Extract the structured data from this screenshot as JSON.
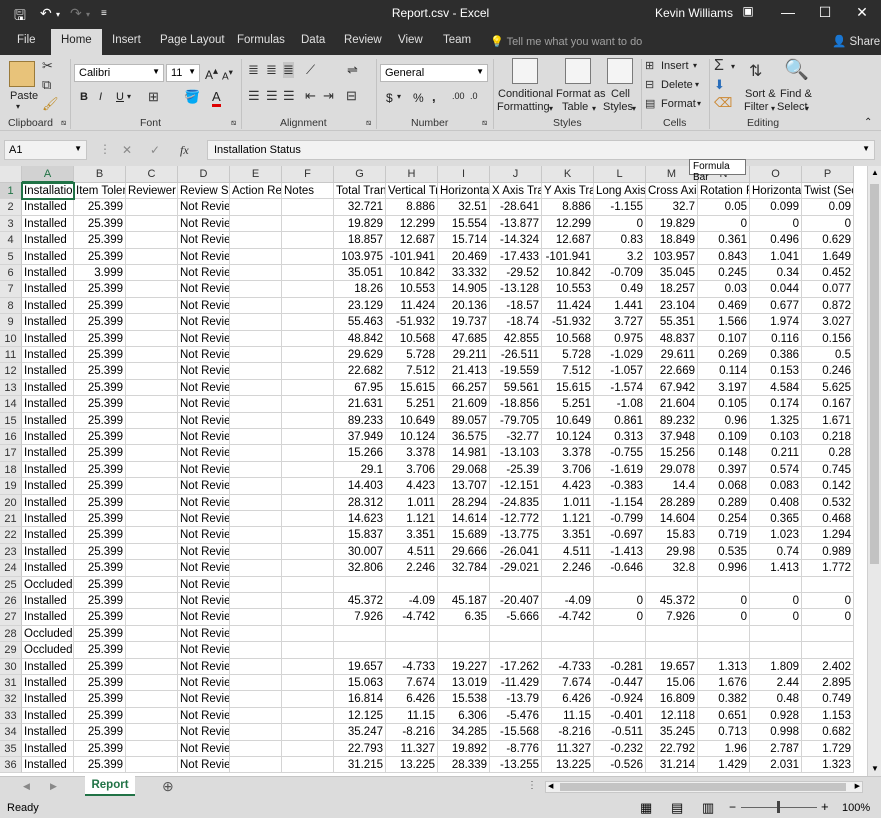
{
  "window": {
    "title": "Report.csv  -  Excel",
    "user": "Kevin Williams"
  },
  "tabs": [
    "File",
    "Home",
    "Insert",
    "Page Layout",
    "Formulas",
    "Data",
    "Review",
    "View",
    "Team"
  ],
  "tell_me": "Tell me what you want to do",
  "share": "Share",
  "ribbon": {
    "clipboard": {
      "label": "Clipboard",
      "paste": "Paste"
    },
    "font": {
      "label": "Font",
      "name": "Calibri",
      "size": "11",
      "bold": "B",
      "italic": "I",
      "underline": "U"
    },
    "alignment": {
      "label": "Alignment"
    },
    "number": {
      "label": "Number",
      "format": "General",
      "currency": "$",
      "percent": "%",
      "comma": ","
    },
    "styles": {
      "label": "Styles",
      "conditional": "Conditional",
      "formatting": "Formatting",
      "format_as": "Format as",
      "table": "Table",
      "cell": "Cell",
      "styles": "Styles"
    },
    "cells": {
      "label": "Cells",
      "insert": "Insert",
      "delete": "Delete",
      "format": "Format"
    },
    "editing": {
      "label": "Editing",
      "sort": "Sort &",
      "filter": "Filter",
      "find": "Find &",
      "select": "Select"
    }
  },
  "formula_bar": {
    "name_box": "A1",
    "fx": "fx",
    "content": "Installation Status",
    "tooltip": "Formula Bar"
  },
  "columns": [
    "A",
    "B",
    "C",
    "D",
    "E",
    "F",
    "G",
    "H",
    "I",
    "J",
    "K",
    "L",
    "M",
    "N",
    "O",
    "P"
  ],
  "header_row": [
    "Installation Status",
    "Item Tolerance",
    "Reviewer",
    "Review Status",
    "Action Required",
    "Notes",
    "Total Translation",
    "Vertical Translation",
    "Horizontal Translation",
    "X Axis Translation",
    "Y Axis Translation",
    "Long Axis",
    "Cross Axis",
    "Rotation F",
    "Horizontal",
    "Twist (Sec G"
  ],
  "rows": [
    [
      "Installed",
      "25.399",
      "",
      "Not Reviewed",
      "",
      "",
      "32.721",
      "8.886",
      "32.51",
      "-28.641",
      "8.886",
      "-1.155",
      "32.7",
      "0.05",
      "0.099",
      "0.09"
    ],
    [
      "Installed",
      "25.399",
      "",
      "Not Reviewed",
      "",
      "",
      "19.829",
      "12.299",
      "15.554",
      "-13.877",
      "12.299",
      "0",
      "19.829",
      "0",
      "0",
      "0"
    ],
    [
      "Installed",
      "25.399",
      "",
      "Not Reviewed",
      "",
      "",
      "18.857",
      "12.687",
      "15.714",
      "-14.324",
      "12.687",
      "0.83",
      "18.849",
      "0.361",
      "0.496",
      "0.629"
    ],
    [
      "Installed",
      "25.399",
      "",
      "Not Reviewed",
      "",
      "",
      "103.975",
      "-101.941",
      "20.469",
      "-17.433",
      "-101.941",
      "3.2",
      "103.957",
      "0.843",
      "1.041",
      "1.649"
    ],
    [
      "Installed",
      "3.999",
      "",
      "Not Reviewed",
      "",
      "",
      "35.051",
      "10.842",
      "33.332",
      "-29.52",
      "10.842",
      "-0.709",
      "35.045",
      "0.245",
      "0.34",
      "0.452"
    ],
    [
      "Installed",
      "25.399",
      "",
      "Not Reviewed",
      "",
      "",
      "18.26",
      "10.553",
      "14.905",
      "-13.128",
      "10.553",
      "0.49",
      "18.257",
      "0.03",
      "0.044",
      "0.077"
    ],
    [
      "Installed",
      "25.399",
      "",
      "Not Reviewed",
      "",
      "",
      "23.129",
      "11.424",
      "20.136",
      "-18.57",
      "11.424",
      "1.441",
      "23.104",
      "0.469",
      "0.677",
      "0.872"
    ],
    [
      "Installed",
      "25.399",
      "",
      "Not Reviewed",
      "",
      "",
      "55.463",
      "-51.932",
      "19.737",
      "-18.74",
      "-51.932",
      "3.727",
      "55.351",
      "1.566",
      "1.974",
      "3.027"
    ],
    [
      "Installed",
      "25.399",
      "",
      "Not Reviewed",
      "",
      "",
      "48.842",
      "10.568",
      "47.685",
      "42.855",
      "10.568",
      "0.975",
      "48.837",
      "0.107",
      "0.116",
      "0.156"
    ],
    [
      "Installed",
      "25.399",
      "",
      "Not Reviewed",
      "",
      "",
      "29.629",
      "5.728",
      "29.211",
      "-26.511",
      "5.728",
      "-1.029",
      "29.611",
      "0.269",
      "0.386",
      "0.5"
    ],
    [
      "Installed",
      "25.399",
      "",
      "Not Reviewed",
      "",
      "",
      "22.682",
      "7.512",
      "21.413",
      "-19.559",
      "7.512",
      "-1.057",
      "22.669",
      "0.114",
      "0.153",
      "0.246"
    ],
    [
      "Installed",
      "25.399",
      "",
      "Not Reviewed",
      "",
      "",
      "67.95",
      "15.615",
      "66.257",
      "59.561",
      "15.615",
      "-1.574",
      "67.942",
      "3.197",
      "4.584",
      "5.625"
    ],
    [
      "Installed",
      "25.399",
      "",
      "Not Reviewed",
      "",
      "",
      "21.631",
      "5.251",
      "21.609",
      "-18.856",
      "5.251",
      "-1.08",
      "21.604",
      "0.105",
      "0.174",
      "0.167"
    ],
    [
      "Installed",
      "25.399",
      "",
      "Not Reviewed",
      "",
      "",
      "89.233",
      "10.649",
      "89.057",
      "-79.705",
      "10.649",
      "0.861",
      "89.232",
      "0.96",
      "1.325",
      "1.671"
    ],
    [
      "Installed",
      "25.399",
      "",
      "Not Reviewed",
      "",
      "",
      "37.949",
      "10.124",
      "36.575",
      "-32.77",
      "10.124",
      "0.313",
      "37.948",
      "0.109",
      "0.103",
      "0.218"
    ],
    [
      "Installed",
      "25.399",
      "",
      "Not Reviewed",
      "",
      "",
      "15.266",
      "3.378",
      "14.981",
      "-13.103",
      "3.378",
      "-0.755",
      "15.256",
      "0.148",
      "0.211",
      "0.28"
    ],
    [
      "Installed",
      "25.399",
      "",
      "Not Reviewed",
      "",
      "",
      "29.1",
      "3.706",
      "29.068",
      "-25.39",
      "3.706",
      "-1.619",
      "29.078",
      "0.397",
      "0.574",
      "0.745"
    ],
    [
      "Installed",
      "25.399",
      "",
      "Not Reviewed",
      "",
      "",
      "14.403",
      "4.423",
      "13.707",
      "-12.151",
      "4.423",
      "-0.383",
      "14.4",
      "0.068",
      "0.083",
      "0.142"
    ],
    [
      "Installed",
      "25.399",
      "",
      "Not Reviewed",
      "",
      "",
      "28.312",
      "1.011",
      "28.294",
      "-24.835",
      "1.011",
      "-1.154",
      "28.289",
      "0.289",
      "0.408",
      "0.532"
    ],
    [
      "Installed",
      "25.399",
      "",
      "Not Reviewed",
      "",
      "",
      "14.623",
      "1.121",
      "14.614",
      "-12.772",
      "1.121",
      "-0.799",
      "14.604",
      "0.254",
      "0.365",
      "0.468"
    ],
    [
      "Installed",
      "25.399",
      "",
      "Not Reviewed",
      "",
      "",
      "15.837",
      "3.351",
      "15.689",
      "-13.775",
      "3.351",
      "-0.697",
      "15.83",
      "0.719",
      "1.023",
      "1.294"
    ],
    [
      "Installed",
      "25.399",
      "",
      "Not Reviewed",
      "",
      "",
      "30.007",
      "4.511",
      "29.666",
      "-26.041",
      "4.511",
      "-1.413",
      "29.98",
      "0.535",
      "0.74",
      "0.989"
    ],
    [
      "Installed",
      "25.399",
      "",
      "Not Reviewed",
      "",
      "",
      "32.806",
      "2.246",
      "32.784",
      "-29.021",
      "2.246",
      "-0.646",
      "32.8",
      "0.996",
      "1.413",
      "1.772"
    ],
    [
      "Occluded",
      "25.399",
      "",
      "Not Reviewed",
      "",
      "",
      "",
      "",
      "",
      "",
      "",
      "",
      "",
      "",
      "",
      ""
    ],
    [
      "Installed",
      "25.399",
      "",
      "Not Reviewed",
      "",
      "",
      "45.372",
      "-4.09",
      "45.187",
      "-20.407",
      "-4.09",
      "0",
      "45.372",
      "0",
      "0",
      "0"
    ],
    [
      "Installed",
      "25.399",
      "",
      "Not Reviewed",
      "",
      "",
      "7.926",
      "-4.742",
      "6.35",
      "-5.666",
      "-4.742",
      "0",
      "7.926",
      "0",
      "0",
      "0"
    ],
    [
      "Occluded",
      "25.399",
      "",
      "Not Reviewed",
      "",
      "",
      "",
      "",
      "",
      "",
      "",
      "",
      "",
      "",
      "",
      ""
    ],
    [
      "Occluded",
      "25.399",
      "",
      "Not Reviewed",
      "",
      "",
      "",
      "",
      "",
      "",
      "",
      "",
      "",
      "",
      "",
      ""
    ],
    [
      "Installed",
      "25.399",
      "",
      "Not Reviewed",
      "",
      "",
      "19.657",
      "-4.733",
      "19.227",
      "-17.262",
      "-4.733",
      "-0.281",
      "19.657",
      "1.313",
      "1.809",
      "2.402"
    ],
    [
      "Installed",
      "25.399",
      "",
      "Not Reviewed",
      "",
      "",
      "15.063",
      "7.674",
      "13.019",
      "-11.429",
      "7.674",
      "-0.447",
      "15.06",
      "1.676",
      "2.44",
      "2.895"
    ],
    [
      "Installed",
      "25.399",
      "",
      "Not Reviewed",
      "",
      "",
      "16.814",
      "6.426",
      "15.538",
      "-13.79",
      "6.426",
      "-0.924",
      "16.809",
      "0.382",
      "0.48",
      "0.749"
    ],
    [
      "Installed",
      "25.399",
      "",
      "Not Reviewed",
      "",
      "",
      "12.125",
      "11.15",
      "6.306",
      "-5.476",
      "11.15",
      "-0.401",
      "12.118",
      "0.651",
      "0.928",
      "1.153"
    ],
    [
      "Installed",
      "25.399",
      "",
      "Not Reviewed",
      "",
      "",
      "35.247",
      "-8.216",
      "34.285",
      "-15.568",
      "-8.216",
      "-0.511",
      "35.245",
      "0.713",
      "0.998",
      "0.682"
    ],
    [
      "Installed",
      "25.399",
      "",
      "Not Reviewed",
      "",
      "",
      "22.793",
      "11.327",
      "19.892",
      "-8.776",
      "11.327",
      "-0.232",
      "22.792",
      "1.96",
      "2.787",
      "1.729"
    ],
    [
      "Installed",
      "25.399",
      "",
      "Not Reviewed",
      "",
      "",
      "31.215",
      "13.225",
      "28.339",
      "-13.255",
      "13.225",
      "-0.526",
      "31.214",
      "1.429",
      "2.031",
      "1.323"
    ]
  ],
  "sheet_tab": "Report",
  "status": {
    "ready": "Ready",
    "zoom": "100%"
  },
  "accent_color": "#217346"
}
